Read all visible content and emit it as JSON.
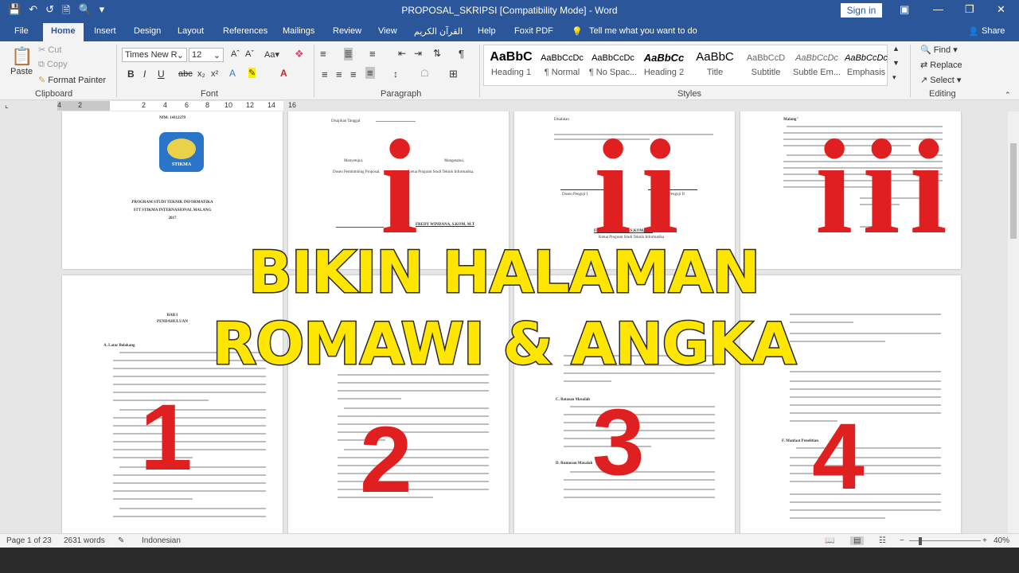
{
  "window": {
    "title": "PROPOSAL_SKRIPSI [Compatibility Mode] - Word",
    "signin": "Sign in"
  },
  "tabs": [
    "File",
    "Home",
    "Insert",
    "Design",
    "Layout",
    "References",
    "Mailings",
    "Review",
    "View",
    "القرآن الكريم",
    "Help",
    "Foxit PDF"
  ],
  "tell_me": "Tell me what you want to do",
  "share": "Share",
  "clipboard": {
    "paste": "Paste",
    "cut": "Cut",
    "copy": "Copy",
    "format_painter": "Format Painter",
    "label": "Clipboard"
  },
  "font": {
    "name": "Times New R",
    "size": "12",
    "label": "Font"
  },
  "paragraph": {
    "label": "Paragraph"
  },
  "styles": {
    "label": "Styles",
    "items": [
      {
        "sample": "AaBbC",
        "name": "Heading 1"
      },
      {
        "sample": "AaBbCcDc",
        "name": "¶ Normal"
      },
      {
        "sample": "AaBbCcDc",
        "name": "¶ No Spac..."
      },
      {
        "sample": "AaBbCc",
        "name": "Heading 2"
      },
      {
        "sample": "AaBbC",
        "name": "Title"
      },
      {
        "sample": "AaBbCcD",
        "name": "Subtitle"
      },
      {
        "sample": "AaBbCcDc",
        "name": "Subtle Em..."
      },
      {
        "sample": "AaBbCcDc",
        "name": "Emphasis"
      }
    ]
  },
  "editing": {
    "find": "Find",
    "replace": "Replace",
    "select": "Select",
    "label": "Editing"
  },
  "ruler_ticks": [
    "4",
    "2",
    "2",
    "4",
    "6",
    "8",
    "10",
    "12",
    "14",
    "16"
  ],
  "pages": {
    "p1": {
      "nim": "NIM: 14112279",
      "program": "PROGRAM STUDI TEKNIK INFORMATIKA",
      "school": "STT STIKMA INTERNASIONAL MALANG",
      "year": "2017",
      "logo": "STIKMA"
    },
    "p2": {
      "date": "Disajikan Tanggal",
      "left_sign": "Menyetujui,",
      "right_sign": "Mengetahui,",
      "left_role": "Dosen Pembimbing Proposal,",
      "right_role": "Ketua Program Studi Teknik Informatika,",
      "name": "FREDY WINDANA, S.KOM, M.T"
    },
    "p3": {
      "date": "Disahkan",
      "n1": "Dosen Penguji I",
      "n2": "Dosen Penguji II",
      "name": "FREDY WINDANA, S.KOM, M.T",
      "role": "Ketua Program Studi Teknik Informatika"
    },
    "p4": {
      "heading": "Malang\""
    },
    "p5": {
      "bab": "BAB I",
      "title": "PENDAHULUAN",
      "sub": "A.   Latar Belakang"
    },
    "p7": {
      "h1": "C.   Batasan Masalah",
      "h2": "D.   Rumusan Masalah"
    },
    "p8": {
      "h1": "F.   Manfaat Penelitian"
    }
  },
  "overlay": {
    "romans": [
      "i",
      "ii",
      "iii"
    ],
    "headline": [
      "BIKIN HALAMAN",
      "ROMAWI & ANGKA"
    ],
    "numbers": [
      "1",
      "2",
      "3",
      "4"
    ]
  },
  "status": {
    "page": "Page 1 of 23",
    "words": "2631 words",
    "language": "Indonesian",
    "zoom": "40%"
  }
}
